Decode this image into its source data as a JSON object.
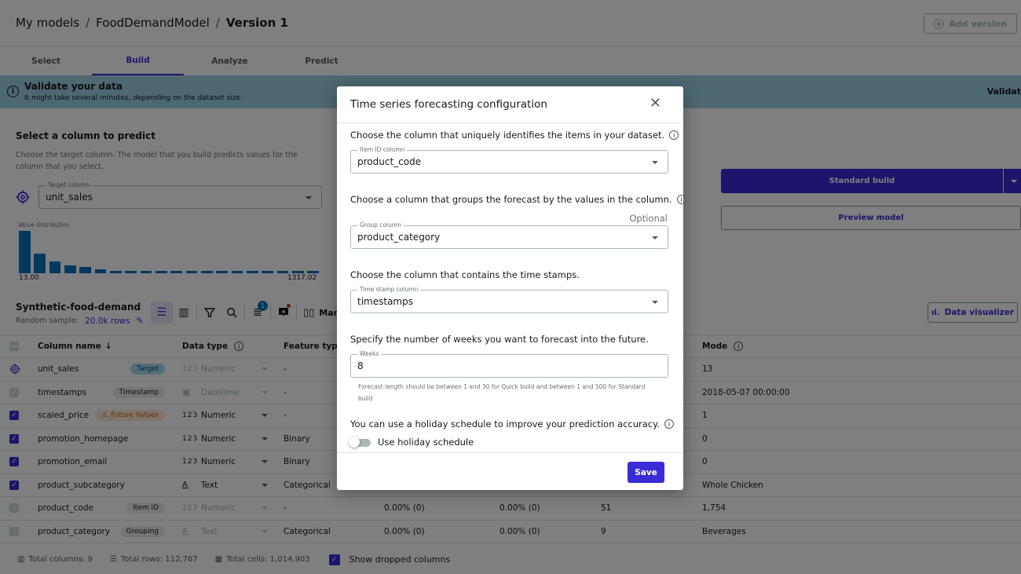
{
  "header": {
    "breadcrumb": [
      "My models",
      "FoodDemandModel",
      "Version 1"
    ],
    "separator": "/",
    "add_version_label": "Add version"
  },
  "tabs": [
    {
      "label": "Select",
      "active": false
    },
    {
      "label": "Build",
      "active": true
    },
    {
      "label": "Analyze",
      "active": false
    },
    {
      "label": "Predict",
      "active": false
    }
  ],
  "banner": {
    "title": "Validate your data",
    "subtitle": "It might take several minutes, depending on the dataset size.",
    "right_label": "Validat"
  },
  "select_column": {
    "title": "Select a column to predict",
    "description": "Choose the target column. The model that you build predicts values for the column that you select.",
    "target_legend": "Target column",
    "target_value": "unit_sales",
    "distribution_label": "Value distribution",
    "distribution_min": "13.00",
    "distribution_max": "1317.02",
    "distribution_relative": [
      1.0,
      0.47,
      0.27,
      0.19,
      0.14,
      0.09,
      0.06,
      0.05,
      0.05,
      0.05,
      0.05,
      0.05,
      0.05,
      0.05,
      0.05,
      0.05,
      0.05,
      0.05,
      0.05,
      0.05
    ]
  },
  "build_actions": {
    "standard_build_label": "Standard build",
    "preview_model_label": "Preview model"
  },
  "dataset": {
    "name": "Synthetic-food-demand",
    "sample_label": "Random sample:",
    "sample_value": "20.0k rows",
    "filter_badge_count": "1",
    "manage_label": "Mana",
    "data_visualizer_label": "Data visualizer"
  },
  "table": {
    "headers": {
      "column_name": "Column name",
      "data_type": "Data type",
      "feature_type": "Feature type",
      "mode": "Mode"
    },
    "rows": [
      {
        "check": "target",
        "name": "unit_sales",
        "tag": "Target",
        "tag_kind": "target",
        "dtype_icon": "123",
        "dtype": "Numeric",
        "dtype_muted": true,
        "ftype": "-",
        "missing": "",
        "mismatched": "",
        "unique": "",
        "mode": "13"
      },
      {
        "check": "disabled",
        "name": "timestamps",
        "tag": "Timestamp",
        "tag_kind": "grey",
        "dtype_icon": "cal",
        "dtype": "Datetime",
        "dtype_muted": true,
        "ftype": "-",
        "missing": "",
        "mismatched": "",
        "unique": "",
        "mode": "2018-05-07 00:00:00"
      },
      {
        "check": "on",
        "name": "scaled_price",
        "tag": "Future Values",
        "tag_kind": "future",
        "dtype_icon": "123",
        "dtype": "Numeric",
        "dtype_muted": false,
        "ftype": "-",
        "missing": "",
        "mismatched": "",
        "unique": "",
        "mode": "1"
      },
      {
        "check": "on",
        "name": "promotion_homepage",
        "tag": "",
        "tag_kind": "",
        "dtype_icon": "123",
        "dtype": "Numeric",
        "dtype_muted": false,
        "ftype": "Binary",
        "missing": "",
        "mismatched": "",
        "unique": "",
        "mode": "0"
      },
      {
        "check": "on",
        "name": "promotion_email",
        "tag": "",
        "tag_kind": "",
        "dtype_icon": "123",
        "dtype": "Numeric",
        "dtype_muted": false,
        "ftype": "Binary",
        "missing": "",
        "mismatched": "",
        "unique": "",
        "mode": "0"
      },
      {
        "check": "on",
        "name": "product_subcategory",
        "tag": "",
        "tag_kind": "",
        "dtype_icon": "A",
        "dtype": "Text",
        "dtype_muted": false,
        "ftype": "Categorical",
        "missing": "",
        "mismatched": "",
        "unique": "",
        "mode": "Whole Chicken"
      },
      {
        "check": "disabled",
        "name": "product_code",
        "tag": "Item ID",
        "tag_kind": "grey",
        "dtype_icon": "123",
        "dtype": "Numeric",
        "dtype_muted": true,
        "ftype": "-",
        "missing": "0.00% (0)",
        "mismatched": "0.00% (0)",
        "unique": "51",
        "mode": "1,754"
      },
      {
        "check": "disabled",
        "name": "product_category",
        "tag": "Grouping",
        "tag_kind": "grey",
        "dtype_icon": "A",
        "dtype": "Text",
        "dtype_muted": true,
        "ftype": "Categorical",
        "missing": "0.00% (0)",
        "mismatched": "0.00% (0)",
        "unique": "9",
        "mode": "Beverages"
      }
    ]
  },
  "footer": {
    "total_columns": "Total columns: 9",
    "total_rows": "Total rows: 112,767",
    "total_cells": "Total cells: 1,014,903",
    "show_dropped_label": "Show dropped columns",
    "show_dropped_checked": true
  },
  "modal": {
    "title": "Time series forecasting configuration",
    "item_id_question": "Choose the column that uniquely identifies the items in your dataset.",
    "item_id_legend": "Item ID column",
    "item_id_value": "product_code",
    "group_question": "Choose a column that groups the forecast by the values in the column.",
    "group_optional": "Optional",
    "group_legend": "Group column",
    "group_value": "product_category",
    "timestamp_question": "Choose the column that contains the time stamps.",
    "timestamp_legend": "Time stamp column",
    "timestamp_value": "timestamps",
    "weeks_question": "Specify the number of weeks you want to forecast into the future.",
    "weeks_legend": "Weeks",
    "weeks_value": "8",
    "weeks_helper": "Forecast length should be between 1 and 30 for Quick build and between 1 and 500 for Standard build",
    "holiday_question": "You can use a holiday schedule to improve your prediction accuracy.",
    "holiday_toggle_label": "Use holiday schedule",
    "holiday_enabled": false,
    "save_label": "Save"
  },
  "colors": {
    "accent": "#3a2bd6",
    "banner": "#9ad0e3",
    "chart_bar": "#0073bb",
    "warning": "#d45b07"
  }
}
